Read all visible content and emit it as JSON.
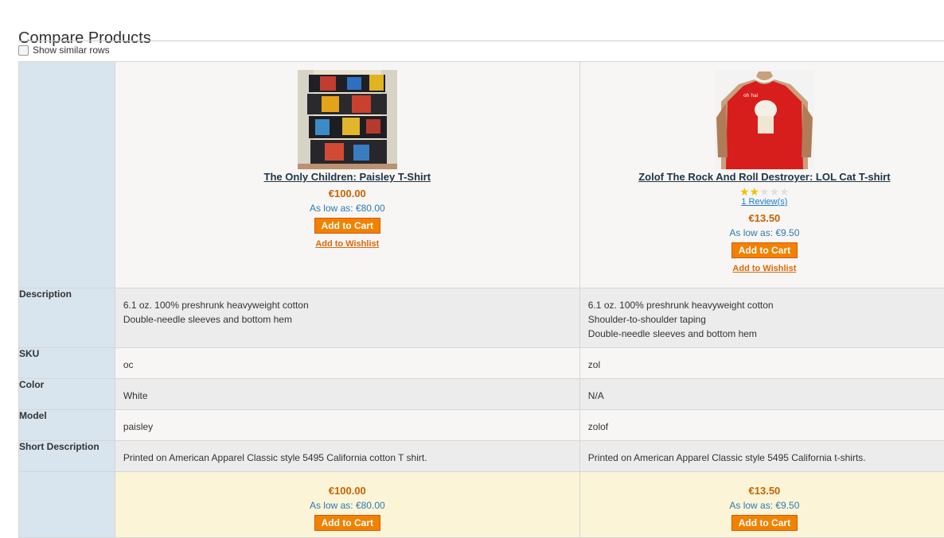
{
  "page": {
    "title": "Compare Products",
    "show_similar_label": "Show similar rows"
  },
  "products": [
    {
      "name": "The Only Children: Paisley T-Shirt",
      "price": "€100.00",
      "as_low_as": "As low as: €80.00",
      "add_to_cart": "Add to Cart",
      "add_to_wishlist": "Add to Wishlist",
      "rating_fraction": null,
      "reviews": null,
      "description": [
        "6.1 oz. 100% preshrunk heavyweight cotton",
        "Double-needle sleeves and bottom hem"
      ],
      "sku": "oc",
      "color": "White",
      "model": "paisley",
      "short_description": "Printed on American Apparel Classic style 5495 California cotton T shirt."
    },
    {
      "name": "Zolof The Rock And Roll Destroyer: LOL Cat T-shirt",
      "price": "€13.50",
      "as_low_as": "As low as: €9.50",
      "add_to_cart": "Add to Cart",
      "add_to_wishlist": "Add to Wishlist",
      "rating_fraction": 0.4,
      "reviews": "1 Review(s)",
      "description": [
        "6.1 oz. 100% preshrunk heavyweight cotton",
        "Shoulder-to-shoulder taping",
        "Double-needle sleeves and bottom hem"
      ],
      "sku": "zol",
      "color": "N/A",
      "model": "zolof",
      "short_description": "Printed on American Apparel Classic style 5495 California t-shirts."
    }
  ],
  "labels": {
    "description": "Description",
    "sku": "SKU",
    "color": "Color",
    "model": "Model",
    "short_description": "Short Description"
  },
  "colors": {
    "price": "#c76200",
    "button": "#f18200",
    "link": "#203548",
    "label_bg": "#d8e4ee",
    "footer_bg": "#fbf4d6"
  }
}
